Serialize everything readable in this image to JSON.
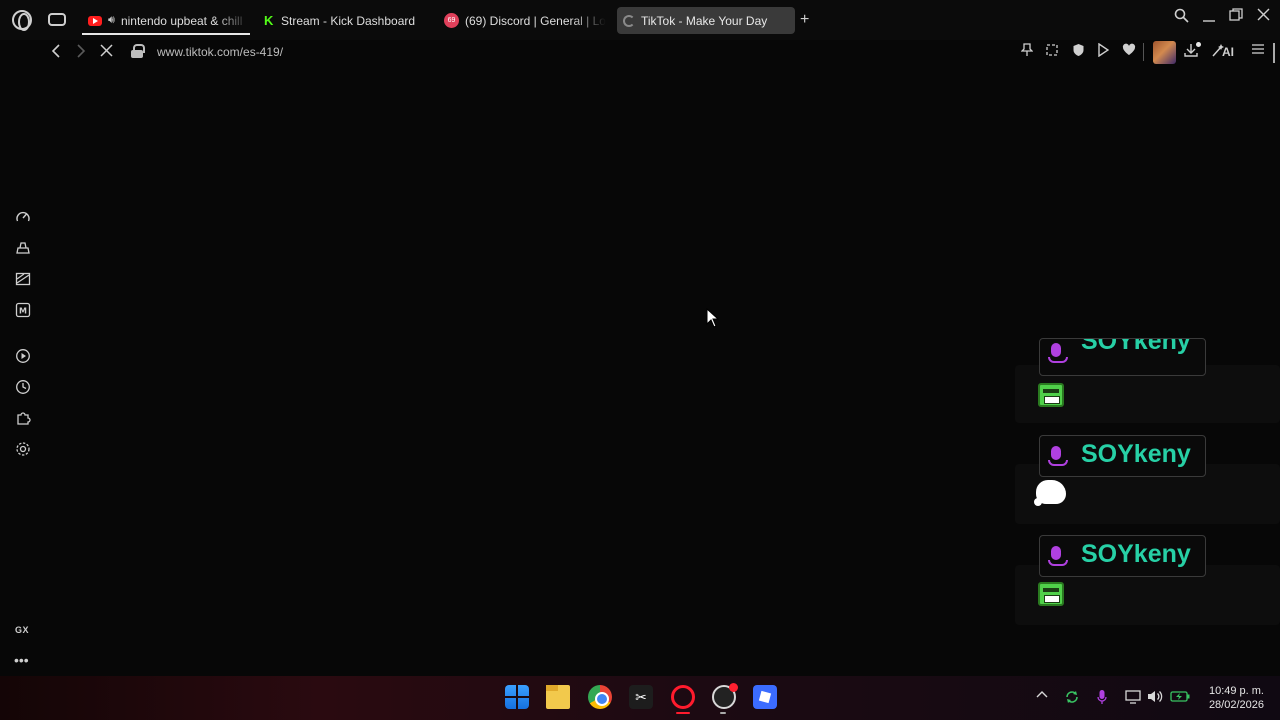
{
  "tabs": [
    {
      "title": "nintendo upbeat & chill",
      "icon": "youtube-icon"
    },
    {
      "title": "Stream - Kick Dashboard",
      "icon": "kick-icon"
    },
    {
      "title": "(69) Discord | General | Lo",
      "icon": "discord-icon",
      "badge": "69"
    },
    {
      "title": "TikTok - Make Your Day",
      "icon": "loading-spinner-icon",
      "active": true
    }
  ],
  "address_bar": {
    "url": "www.tiktok.com/es-419/"
  },
  "toolbar": {
    "ai_label": "AI"
  },
  "sidebar": {
    "gx_label": "GX",
    "more_label": "•••"
  },
  "chat": {
    "messages": [
      {
        "nick": "SOYkeny",
        "emote": "green-monster-emote"
      },
      {
        "nick": "SOYkeny",
        "emote": "white-cloud-emote"
      },
      {
        "nick": "SOYkeny",
        "emote": "green-monster-emote"
      }
    ]
  },
  "clock": {
    "time": "10:49 p. m.",
    "date": "28/02/2026"
  },
  "colors": {
    "nick": "#27d0a6",
    "mic": "#b040e0",
    "accent": "#ff1b2d"
  }
}
